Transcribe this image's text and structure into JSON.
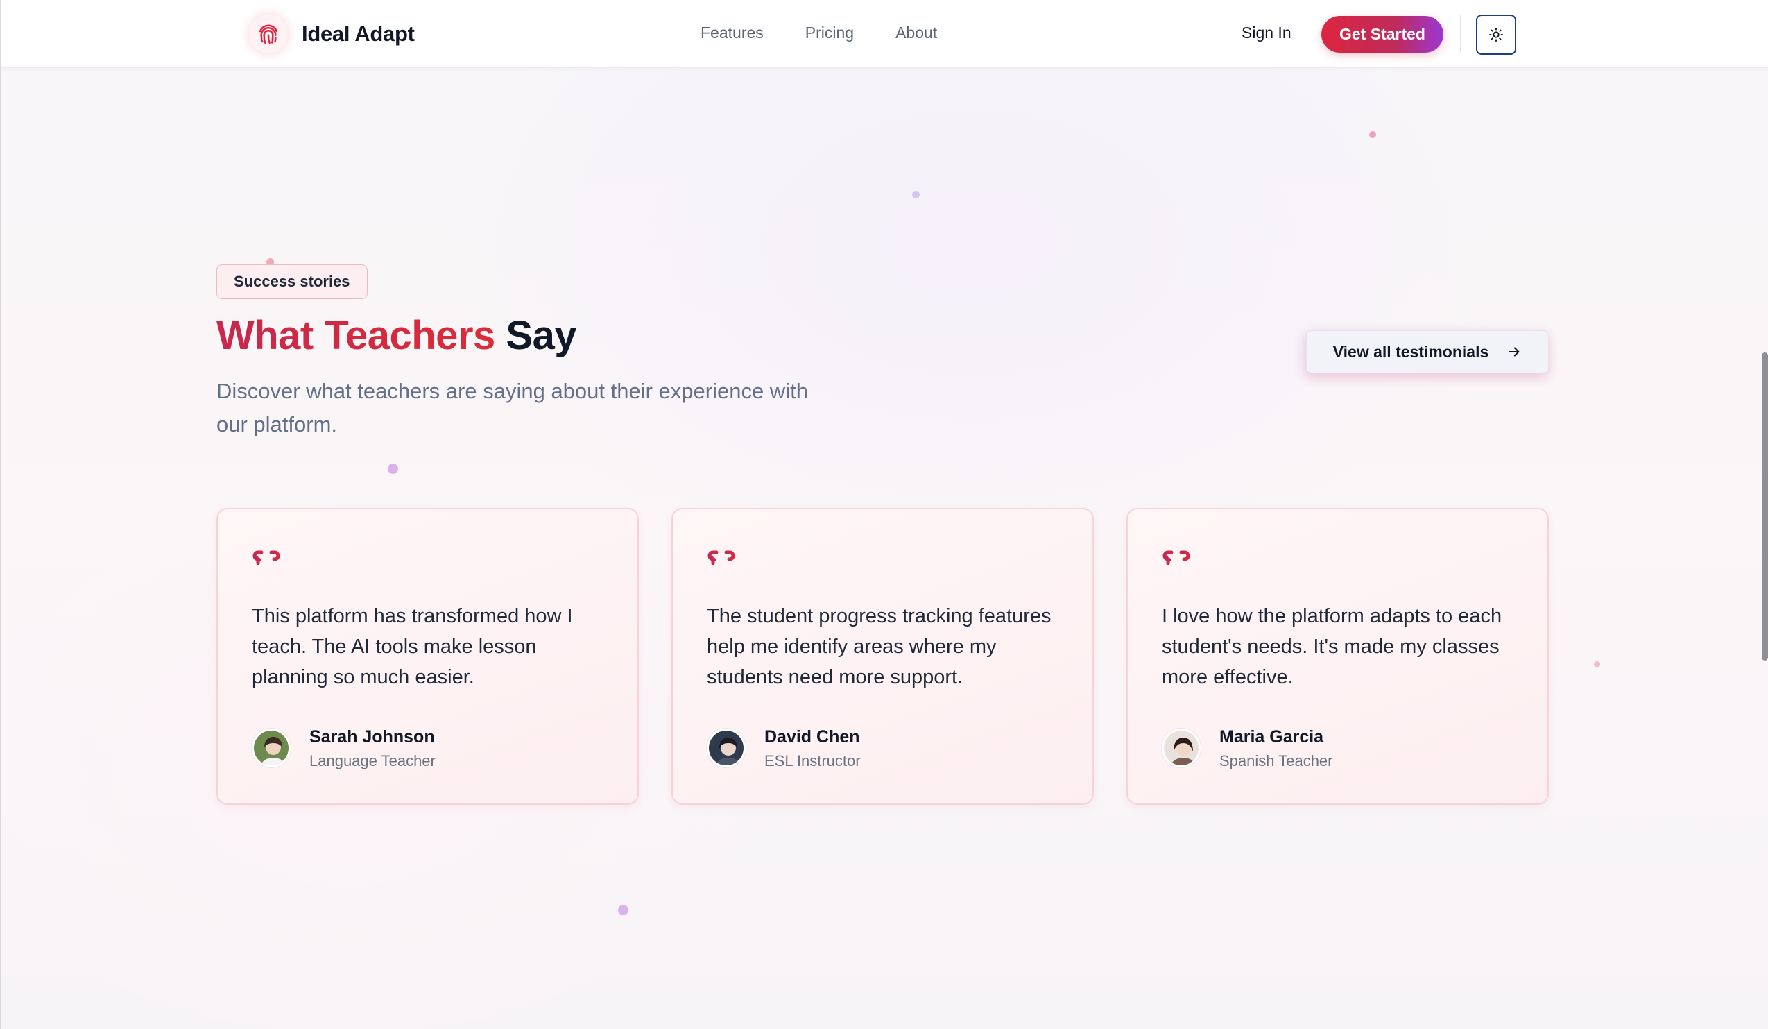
{
  "header": {
    "brand_name": "Ideal Adapt",
    "nav": [
      "Features",
      "Pricing",
      "About"
    ],
    "sign_in": "Sign In",
    "get_started": "Get Started",
    "theme_icon": "sun-icon"
  },
  "section": {
    "badge": "Success stories",
    "title_accent": "What Teachers",
    "title_rest": "Say",
    "subtitle": "Discover what teachers are saying about their experience with our platform.",
    "view_all": "View all testimonials"
  },
  "testimonials": [
    {
      "quote": "This platform has transformed how I teach. The AI tools make lesson planning so much easier.",
      "name": "Sarah Johnson",
      "role": "Language Teacher"
    },
    {
      "quote": "The student progress tracking features help me identify areas where my students need more support.",
      "name": "David Chen",
      "role": "ESL Instructor"
    },
    {
      "quote": "I love how the platform adapts to each student's needs. It's made my classes more effective.",
      "name": "Maria Garcia",
      "role": "Spanish Teacher"
    }
  ],
  "colors": {
    "accent_red": "#dc2640",
    "accent_purple": "#9b37d4",
    "text_muted": "#64708a"
  }
}
